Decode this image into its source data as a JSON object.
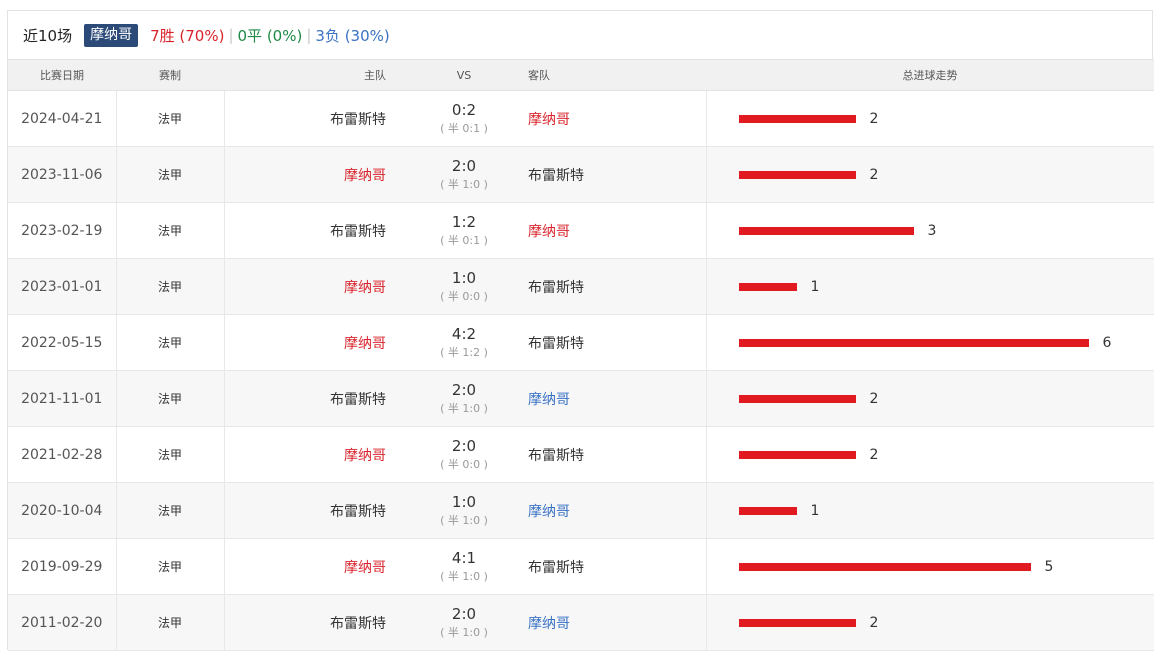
{
  "summary": {
    "title": "近10场",
    "team": "摩纳哥",
    "win": "7胜 (70%)",
    "sep1": "|",
    "draw": "0平 (0%)",
    "sep2": "|",
    "loss": "3负 (30%)"
  },
  "headers": {
    "date": "比赛日期",
    "league": "赛制",
    "home": "主队",
    "vs": "VS",
    "away": "客队",
    "trend": "总进球走势"
  },
  "colors": {
    "win_red": "#d9242b",
    "draw_green": "#1e8a47",
    "loss_blue": "#3a72c4",
    "bar_red": "#e01a1f",
    "tag_bg": "#2c4a78"
  },
  "matches": [
    {
      "date": "2024-04-21",
      "league": "法甲",
      "home": "布雷斯特",
      "home_style": "plain",
      "score": "0:2",
      "half": "( 半 0:1 )",
      "away": "摩纳哥",
      "away_style": "red",
      "total_goals": 2
    },
    {
      "date": "2023-11-06",
      "league": "法甲",
      "home": "摩纳哥",
      "home_style": "red",
      "score": "2:0",
      "half": "( 半 1:0 )",
      "away": "布雷斯特",
      "away_style": "plain",
      "total_goals": 2
    },
    {
      "date": "2023-02-19",
      "league": "法甲",
      "home": "布雷斯特",
      "home_style": "plain",
      "score": "1:2",
      "half": "( 半 0:1 )",
      "away": "摩纳哥",
      "away_style": "red",
      "total_goals": 3
    },
    {
      "date": "2023-01-01",
      "league": "法甲",
      "home": "摩纳哥",
      "home_style": "red",
      "score": "1:0",
      "half": "( 半 0:0 )",
      "away": "布雷斯特",
      "away_style": "plain",
      "total_goals": 1
    },
    {
      "date": "2022-05-15",
      "league": "法甲",
      "home": "摩纳哥",
      "home_style": "red",
      "score": "4:2",
      "half": "( 半 1:2 )",
      "away": "布雷斯特",
      "away_style": "plain",
      "total_goals": 6
    },
    {
      "date": "2021-11-01",
      "league": "法甲",
      "home": "布雷斯特",
      "home_style": "plain",
      "score": "2:0",
      "half": "( 半 1:0 )",
      "away": "摩纳哥",
      "away_style": "blue",
      "total_goals": 2
    },
    {
      "date": "2021-02-28",
      "league": "法甲",
      "home": "摩纳哥",
      "home_style": "red",
      "score": "2:0",
      "half": "( 半 0:0 )",
      "away": "布雷斯特",
      "away_style": "plain",
      "total_goals": 2
    },
    {
      "date": "2020-10-04",
      "league": "法甲",
      "home": "布雷斯特",
      "home_style": "plain",
      "score": "1:0",
      "half": "( 半 1:0 )",
      "away": "摩纳哥",
      "away_style": "blue",
      "total_goals": 1
    },
    {
      "date": "2019-09-29",
      "league": "法甲",
      "home": "摩纳哥",
      "home_style": "red",
      "score": "4:1",
      "half": "( 半 1:0 )",
      "away": "布雷斯特",
      "away_style": "plain",
      "total_goals": 5
    },
    {
      "date": "2011-02-20",
      "league": "法甲",
      "home": "布雷斯特",
      "home_style": "plain",
      "score": "2:0",
      "half": "( 半 1:0 )",
      "away": "摩纳哥",
      "away_style": "blue",
      "total_goals": 2
    }
  ]
}
